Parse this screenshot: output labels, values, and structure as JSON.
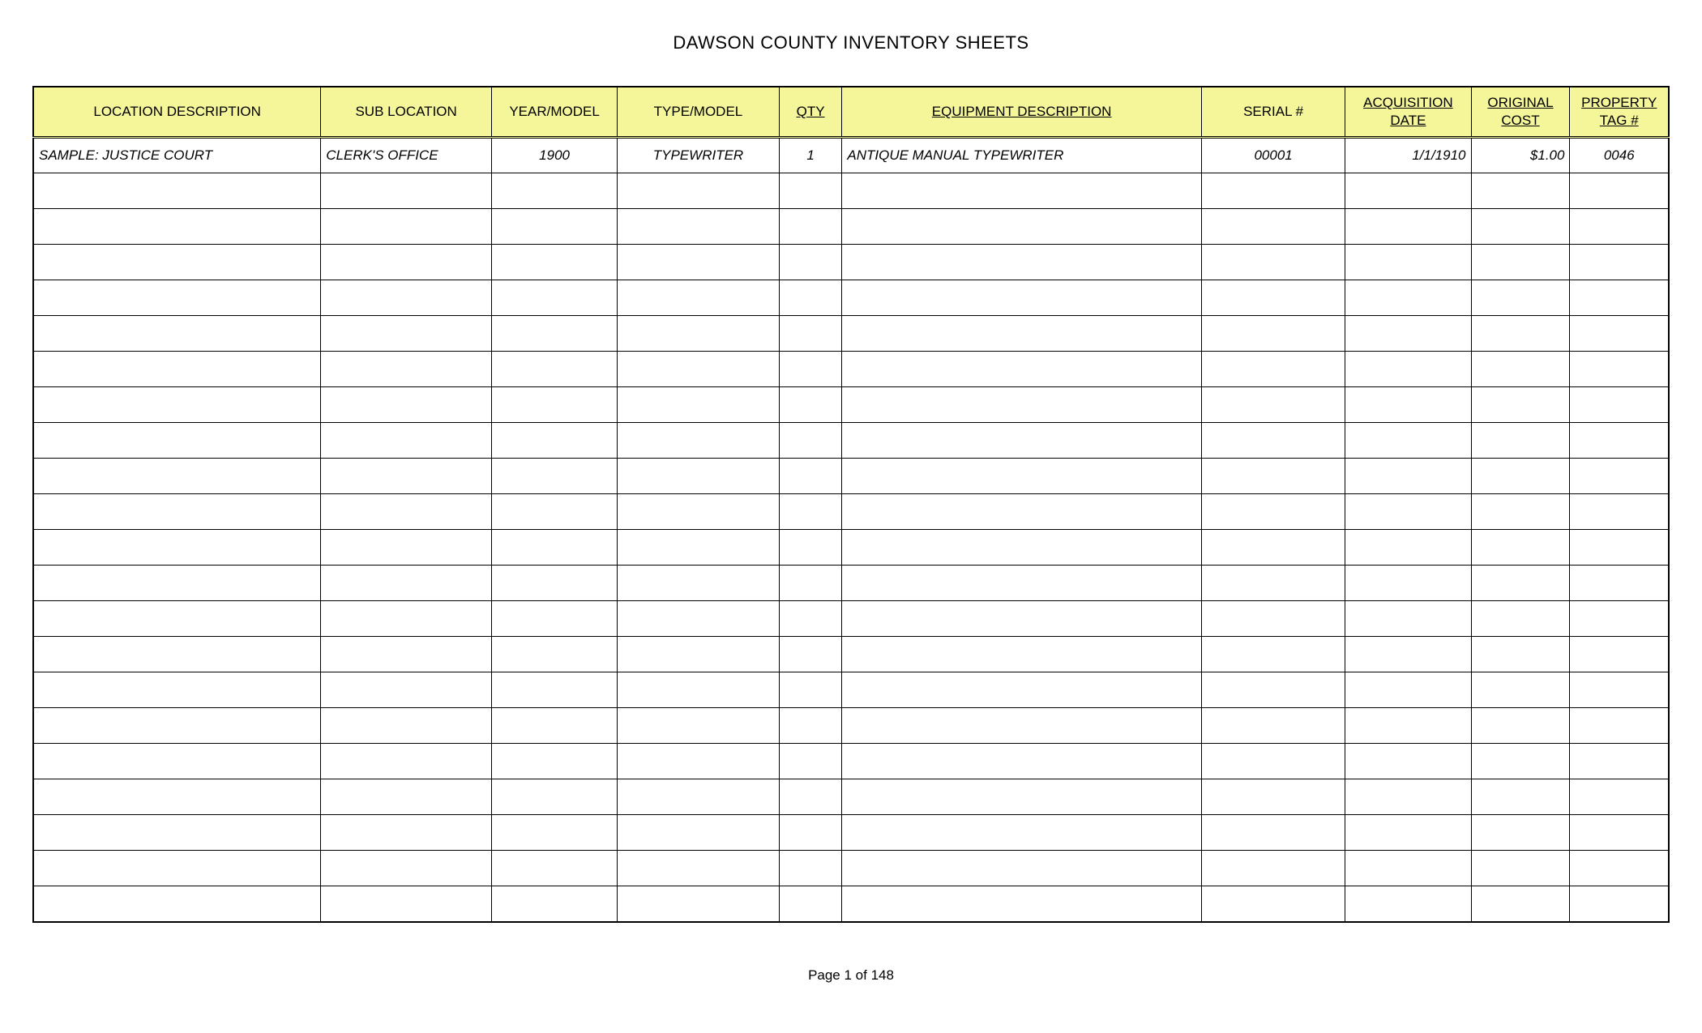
{
  "title": "DAWSON COUNTY INVENTORY SHEETS",
  "columns": [
    {
      "label": "LOCATION DESCRIPTION",
      "class": "col-location",
      "underline": false
    },
    {
      "label": "SUB LOCATION",
      "class": "col-sublocation",
      "underline": false
    },
    {
      "label": "YEAR/MODEL",
      "class": "col-yearmodel",
      "underline": false
    },
    {
      "label": "TYPE/MODEL",
      "class": "col-typemodel",
      "underline": false
    },
    {
      "label": "QTY",
      "class": "col-qty",
      "underline": true
    },
    {
      "label": "EQUIPMENT DESCRIPTION",
      "class": "col-equipdesc",
      "underline": true
    },
    {
      "label": "SERIAL #",
      "class": "col-serial",
      "underline": false
    },
    {
      "label": "ACQUISITION DATE",
      "class": "col-acqdate",
      "underline": true
    },
    {
      "label": "ORIGINAL COST",
      "class": "col-origcost",
      "underline": true
    },
    {
      "label": "PROPERTY TAG #",
      "class": "col-proptag",
      "underline": true
    }
  ],
  "rows": [
    {
      "location": "SAMPLE: JUSTICE COURT",
      "sublocation": "CLERK'S OFFICE",
      "yearmodel": "1900",
      "typemodel": "TYPEWRITER",
      "qty": "1",
      "equipdesc": "ANTIQUE MANUAL TYPEWRITER",
      "serial": "00001",
      "acqdate": "1/1/1910",
      "origcost": "$1.00",
      "proptag": "0046"
    }
  ],
  "empty_row_count": 21,
  "footer": "Page 1 of 148"
}
